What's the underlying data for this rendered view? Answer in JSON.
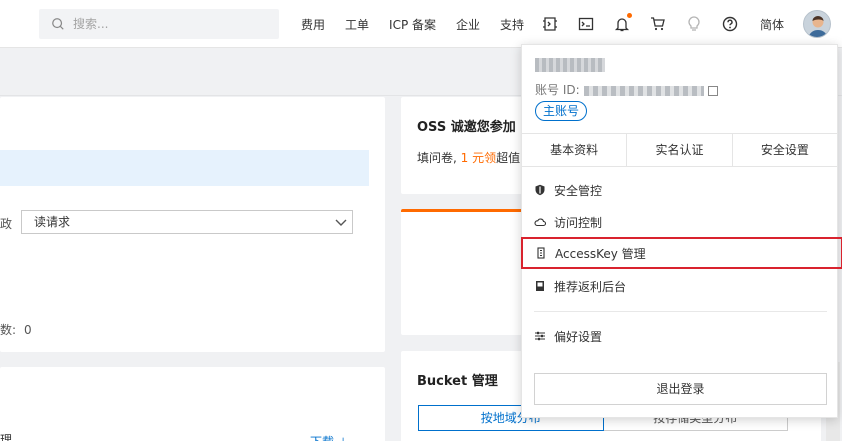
{
  "header": {
    "search_placeholder": "搜索...",
    "nav": [
      "费用",
      "工单",
      "ICP 备案",
      "企业",
      "支持"
    ],
    "language": "简体",
    "icons": [
      "terminal-app-icon",
      "console-icon",
      "bell-icon",
      "cart-icon",
      "lightbulb-icon",
      "help-icon"
    ]
  },
  "left": {
    "row_suffix": "政",
    "select_value": "读请求",
    "stat_suffix": "数:",
    "stat_value": "0",
    "row_prefix": "理",
    "download_label": "下载 ⊥"
  },
  "oss_card": {
    "title": "OSS 诚邀您参加",
    "sub_prefix": "填问卷, ",
    "sub_highlight": "1 元领",
    "sub_suffix": "超值"
  },
  "bucket_card": {
    "title": "Bucket 管理",
    "tabs": [
      "按地域分布",
      "按存储类型分布"
    ]
  },
  "account_menu": {
    "id_label": "账号 ID:",
    "badge": "主账号",
    "tabs": [
      "基本资料",
      "实名认证",
      "安全设置"
    ],
    "items": [
      {
        "label": "安全管控",
        "icon": "shield-icon"
      },
      {
        "label": "访问控制",
        "icon": "cloud-icon"
      },
      {
        "label": "AccessKey 管理",
        "icon": "key-icon"
      },
      {
        "label": "推荐返利后台",
        "icon": "book-icon"
      },
      {
        "label": "偏好设置",
        "icon": "sliders-icon"
      }
    ],
    "logout": "退出登录"
  },
  "colors": {
    "accent": "#0070cc",
    "orange": "#ff6a00",
    "highlight_border": "#d9232e"
  }
}
